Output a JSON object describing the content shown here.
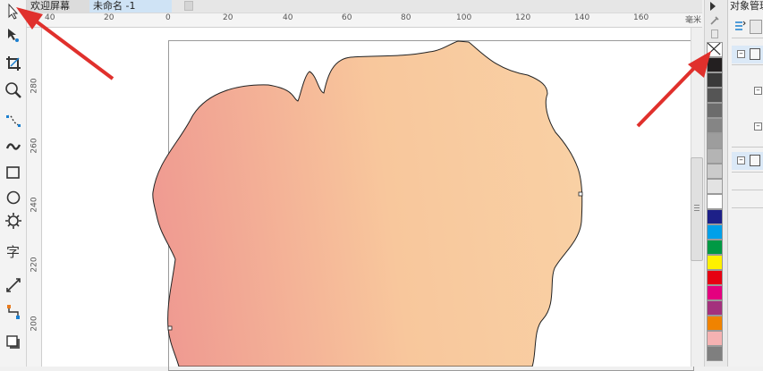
{
  "tabs": [
    {
      "label": "欢迎屏幕"
    },
    {
      "label": "未命名 -1"
    }
  ],
  "ruler": {
    "top_ticks": [
      "40",
      "20",
      "0",
      "20",
      "40",
      "60",
      "80",
      "100",
      "120",
      "140",
      "160"
    ],
    "top_unit": "毫米",
    "left_ticks": [
      "280",
      "260",
      "240",
      "220",
      "200"
    ]
  },
  "docker": {
    "title": "对象管理器"
  },
  "palette": {
    "colors": [
      "#231f20",
      "#3a3a3a",
      "#555555",
      "#6c6c6c",
      "#858585",
      "#9d9d9d",
      "#b4b4b4",
      "#cbcbcb",
      "#e3e3e3",
      "#ffffff",
      "#1d2088",
      "#00a0e9",
      "#009944",
      "#fff100",
      "#e60012",
      "#e4007f",
      "#a4317d",
      "#f08300",
      "#f5b2b2",
      "#7f7f7f"
    ]
  },
  "shape": {
    "gradient_left_color": "#ef9a91",
    "gradient_right_color": "#f9d0a4"
  },
  "annotation_color": "#e0302c"
}
